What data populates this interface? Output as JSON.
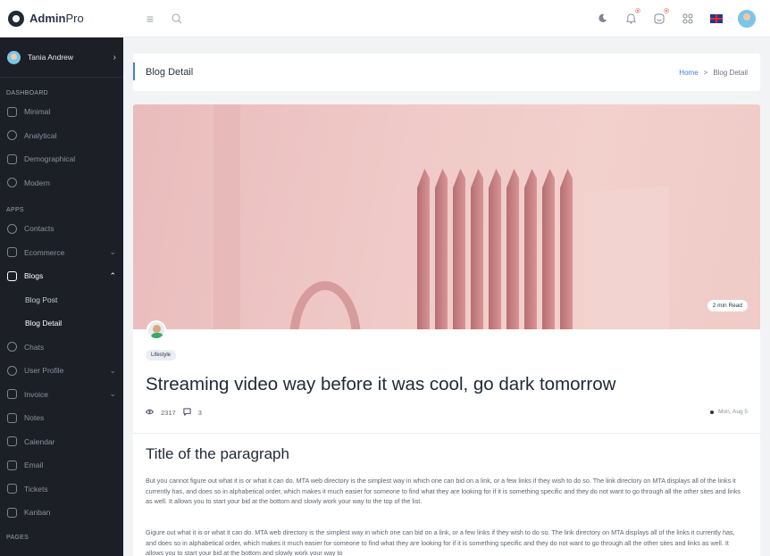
{
  "brand": {
    "name_bold": "Admin",
    "name_light": "Pro"
  },
  "topbar": {
    "icons": [
      "menu-icon",
      "search-icon",
      "moon-icon",
      "bell-icon",
      "message-icon",
      "apps-icon",
      "flag-uk-icon",
      "avatar"
    ]
  },
  "sidebar": {
    "user_name": "Tania Andrew",
    "sections": {
      "dashboard": "DASHBOARD",
      "apps": "APPS",
      "pages": "PAGES"
    },
    "dashboard_items": [
      "Minimal",
      "Analytical",
      "Demographical",
      "Modern"
    ],
    "apps_items": {
      "contacts": "Contacts",
      "ecommerce": "Ecommerce",
      "blogs": "Blogs",
      "blog_post": "Blog Post",
      "blog_detail": "Blog Detail",
      "chats": "Chats",
      "user_profile": "User Profile",
      "invoice": "Invoice",
      "notes": "Notes",
      "calendar": "Calendar",
      "email": "Email",
      "tickets": "Tickets",
      "kanban": "Kanban"
    }
  },
  "page_header": {
    "title": "Blog Detail",
    "breadcrumb_home": "Home",
    "breadcrumb_sep": ">",
    "breadcrumb_current": "Blog Detail"
  },
  "post": {
    "read_time": "2 min Read",
    "tag": "Lifestyle",
    "title": "Streaming video way before it was cool, go dark tomorrow",
    "views": "2317",
    "comments": "3",
    "date": "Mon, Aug 5",
    "section_title": "Title of the paragraph",
    "paragraph1": "But you cannot figure out what it is or what it can do. MTA web directory is the simplest way in which one can bid on a link, or a few links if they wish to do so. The link directory on MTA displays all of the links it currently has, and does so in alphabetical order, which makes it much easier for someone to find what they are looking for if it is something specific and they do not want to go through all the other sites and links as well. It allows you to start your bid at the bottom and slowly work your way to the top of the list.",
    "paragraph2": "Gigure out what it is or what it can do. MTA web directory is the simplest way in which one can bid on a link, or a few links if they wish to do so. The link directory on MTA displays all of the links it currently has, and does so in alphabetical order, which makes it much easier for someone to find what they are looking for if it is something specific and they do not want to go through all the other sites and links as well. It allows you to start your bid at the bottom and slowly work your way to"
  },
  "colors": {
    "accent": "#3d80e0",
    "sidebar_bg": "#1c1f26",
    "page_bg": "#f2f3f5"
  }
}
